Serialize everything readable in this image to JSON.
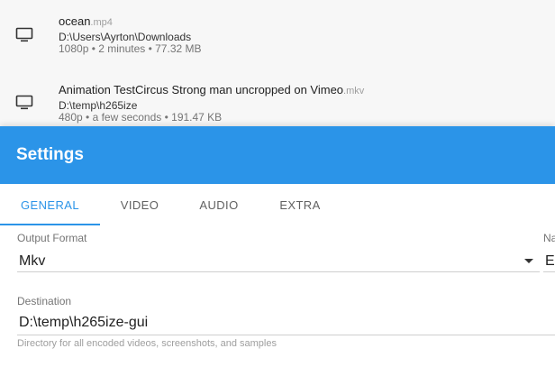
{
  "files": [
    {
      "name": "ocean",
      "ext": ".mp4",
      "path": "D:\\Users\\Ayrton\\Downloads",
      "meta": "1080p • 2 minutes • 77.32 MB",
      "icon": "monitor-icon"
    },
    {
      "name": "Animation TestCircus Strong man uncropped on Vimeo",
      "ext": ".mkv",
      "path": "D:\\temp\\h265ize",
      "meta": "480p • a few seconds • 191.47 KB",
      "icon": "monitor-icon"
    }
  ],
  "settings": {
    "title": "Settings",
    "accent_color": "#2b94e8",
    "tabs": [
      {
        "label": "GENERAL",
        "active": true
      },
      {
        "label": "VIDEO",
        "active": false
      },
      {
        "label": "AUDIO",
        "active": false
      },
      {
        "label": "EXTRA",
        "active": false
      }
    ],
    "output_format": {
      "label": "Output Format",
      "value": "Mkv"
    },
    "naming": {
      "label": "Na",
      "value": "En"
    },
    "destination": {
      "label": "Destination",
      "value": "D:\\temp\\h265ize-gui",
      "helper": "Directory for all encoded videos, screenshots, and samples"
    }
  }
}
